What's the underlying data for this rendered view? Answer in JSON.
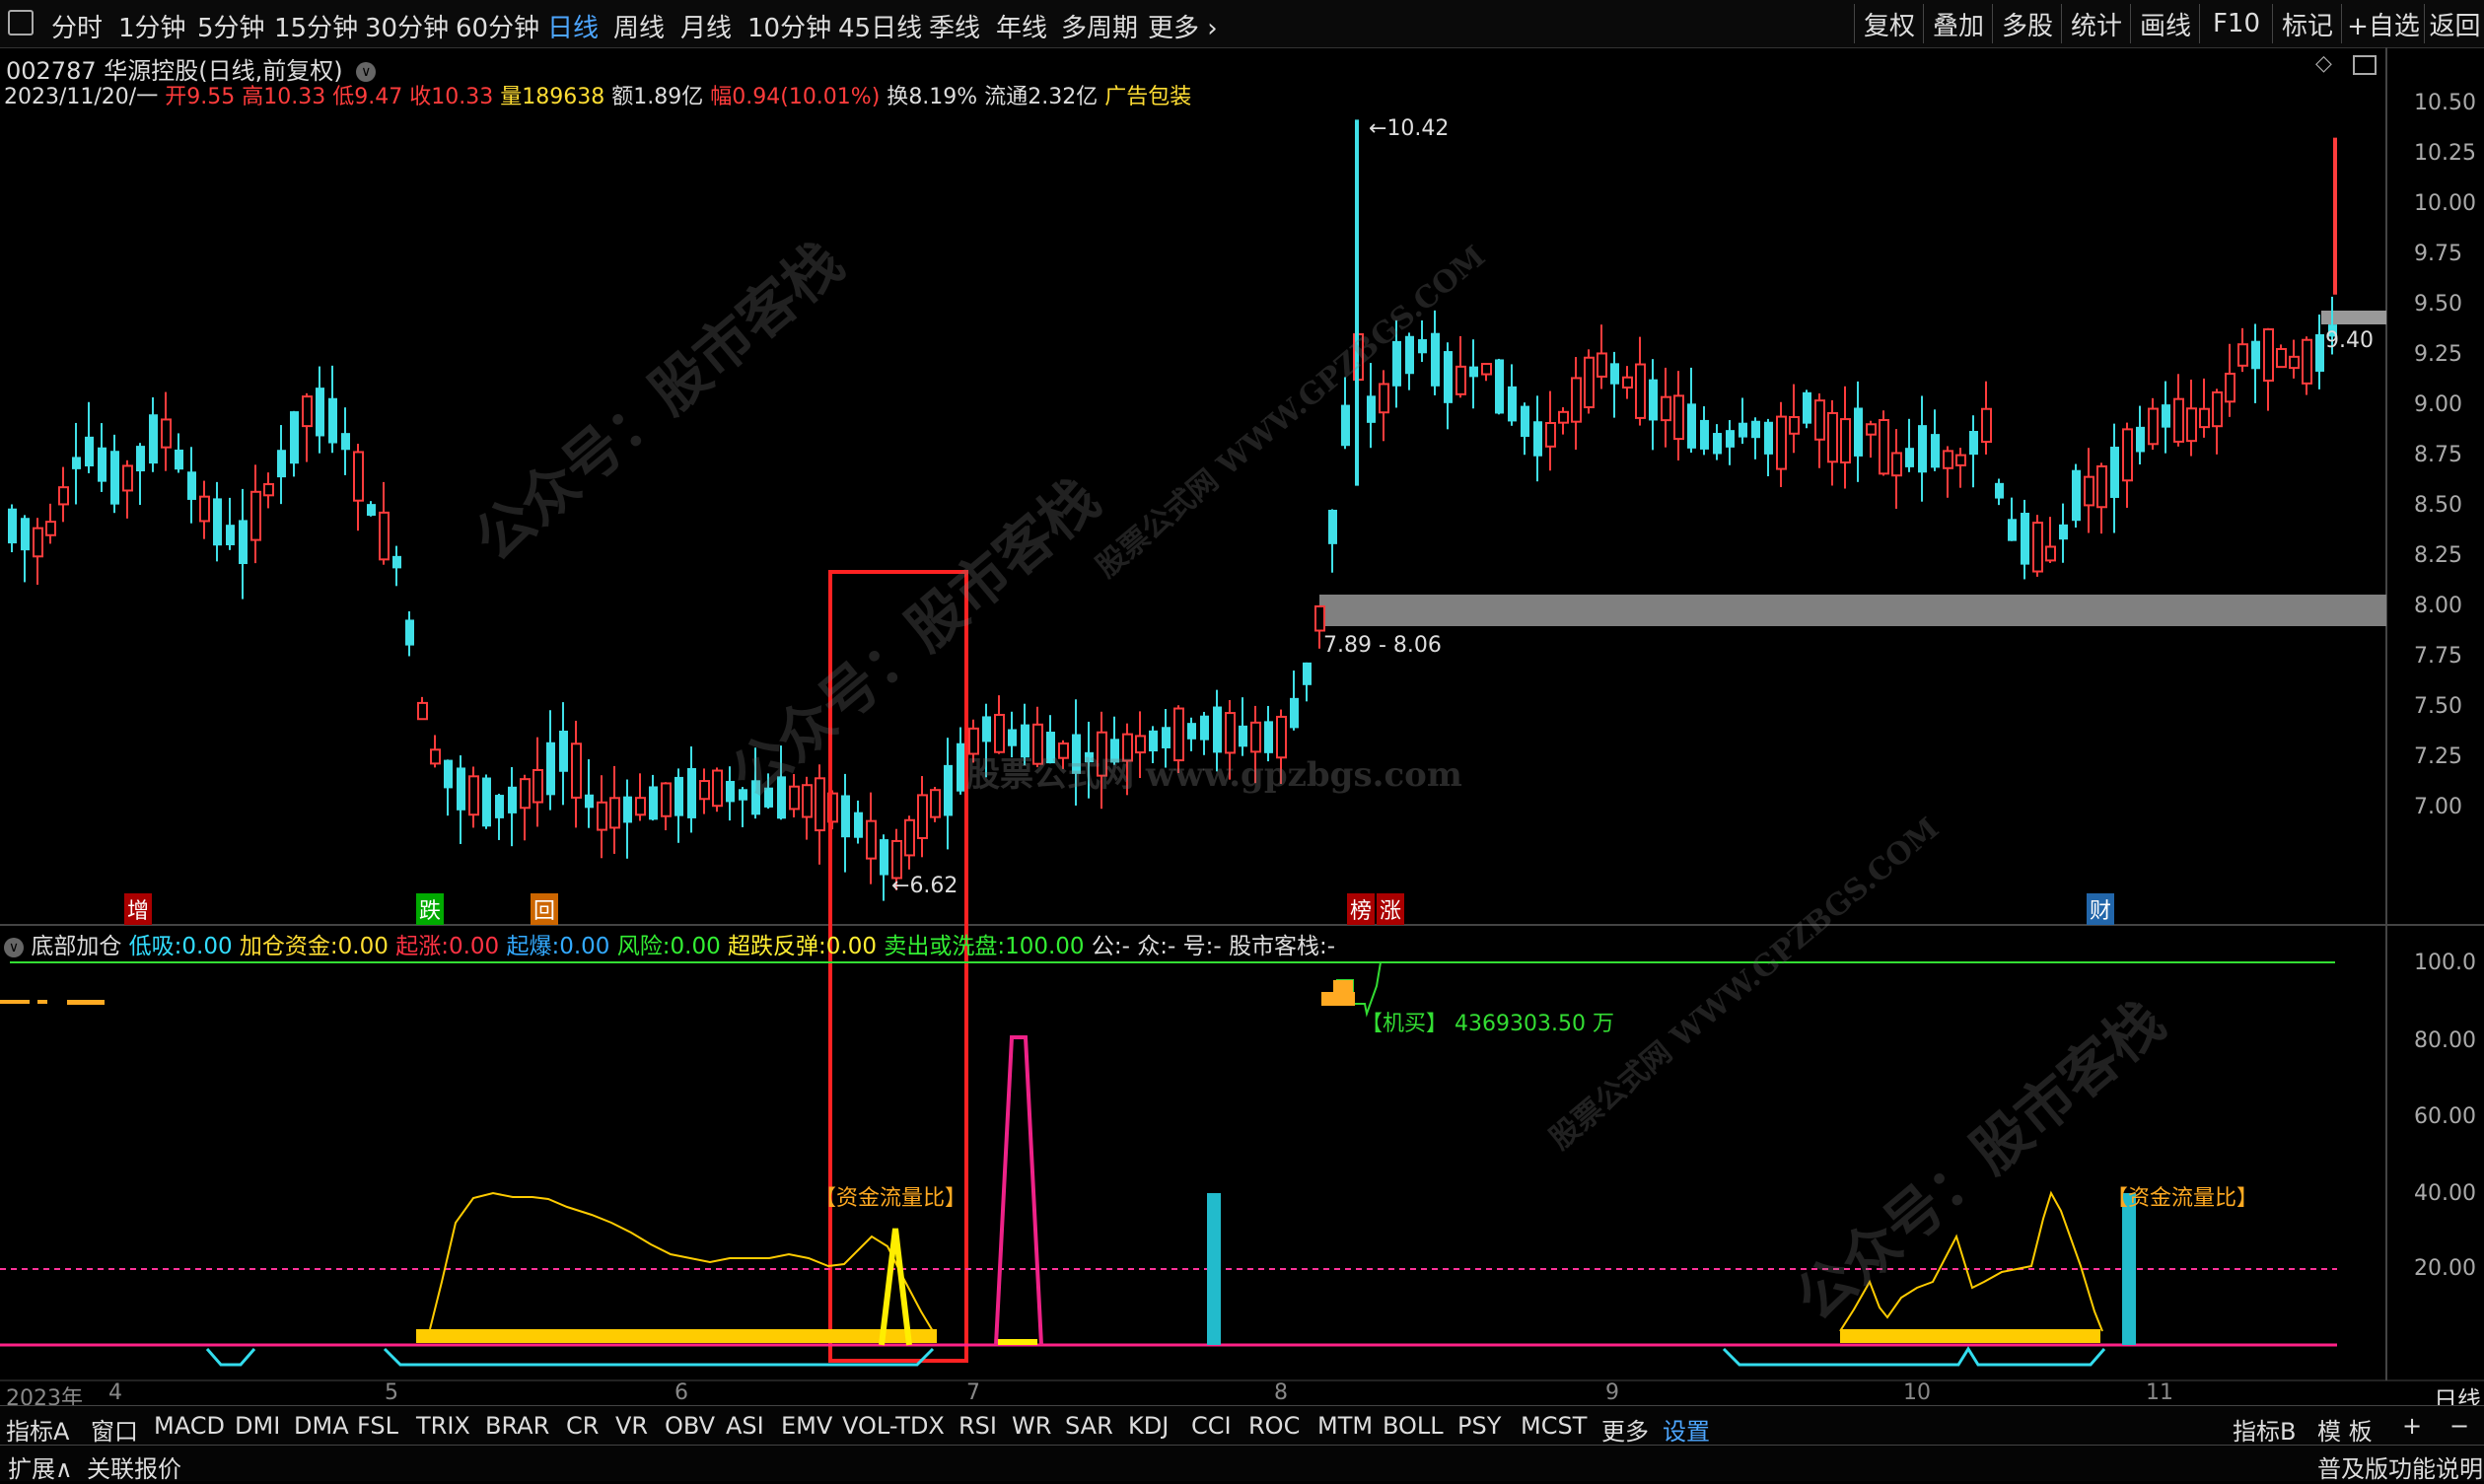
{
  "toolbar": {
    "menu_icon": "menu-icon",
    "periods": [
      "分时",
      "1分钟",
      "5分钟",
      "15分钟",
      "30分钟",
      "60分钟",
      "日线",
      "周线",
      "月线",
      "10分钟",
      "45日线",
      "季线",
      "年线",
      "多周期",
      "更多"
    ],
    "active_period": "日线",
    "right_buttons": [
      "复权",
      "叠加",
      "多股",
      "统计",
      "画线",
      "F10",
      "标记",
      "+自选",
      "返回"
    ]
  },
  "stock": {
    "title": "002787 华源控股(日线,前复权)",
    "date": "2023/11/20/一",
    "open_label": "开",
    "open": "9.55",
    "high_label": "高",
    "high": "10.33",
    "low_label": "低",
    "low": "9.47",
    "close_label": "收",
    "close": "10.33",
    "vol_label": "量",
    "vol": "189638",
    "amt_label": "额",
    "amt": "1.89亿",
    "chg_label": "幅",
    "chg": "0.94(10.01%)",
    "turn_label": "换",
    "turn": "8.19%",
    "float_label": "流通",
    "float": "2.32亿",
    "industry": "广告包装"
  },
  "price_axis": {
    "ticks": [
      "10.50",
      "10.25",
      "10.00",
      "9.75",
      "9.50",
      "9.25",
      "9.00",
      "8.75",
      "8.50",
      "8.25",
      "8.00",
      "7.75",
      "7.50",
      "7.25",
      "7.00"
    ],
    "current": "9.40"
  },
  "annotations": {
    "high": "10.42",
    "low": "6.62",
    "zone": "7.89 - 8.06",
    "markers": [
      {
        "label": "增",
        "color": "#ff4444"
      },
      {
        "label": "跌",
        "color": "#33dd33"
      },
      {
        "label": "回",
        "color": "#ff8844"
      },
      {
        "label": "榜",
        "color": "#ff4444"
      },
      {
        "label": "涨",
        "color": "#ff4444"
      },
      {
        "label": "财",
        "color": "#4da6ff"
      }
    ]
  },
  "indicator": {
    "name": "底部加仓",
    "items": [
      {
        "label": "低吸:",
        "value": "0.00",
        "color": "#33ddff"
      },
      {
        "label": "加仓资金:",
        "value": "0.00",
        "color": "#ffdd33"
      },
      {
        "label": "起涨:",
        "value": "0.00",
        "color": "#ff3344"
      },
      {
        "label": "起爆:",
        "value": "0.00",
        "color": "#33aaff"
      },
      {
        "label": "风险:",
        "value": "0.00",
        "color": "#33ee33"
      },
      {
        "label": "超跌反弹:",
        "value": "0.00",
        "color": "#ffee33"
      },
      {
        "label": "卖出或洗盘:",
        "value": "100.00",
        "color": "#33ee33"
      },
      {
        "label": "公:",
        "value": "-",
        "color": "#ddd"
      },
      {
        "label": "众:",
        "value": "-",
        "color": "#ddd"
      },
      {
        "label": "号:",
        "value": "-",
        "color": "#ddd"
      },
      {
        "label": "股市客栈:",
        "value": "-",
        "color": "#ddd"
      }
    ],
    "jimai_label": "【机买】",
    "jimai_value": "4369303.50 万",
    "flow_label_left": "【资金流量比】",
    "flow_label_right": "【资金流量比】",
    "axis_ticks": [
      "100.0",
      "80.00",
      "60.00",
      "40.00",
      "20.00"
    ]
  },
  "time_axis": {
    "labels": [
      "2023年",
      "4",
      "5",
      "6",
      "7",
      "8",
      "9",
      "10",
      "11"
    ],
    "period": "日线"
  },
  "bottom_tabs": {
    "row1": [
      "指标A",
      "窗口",
      "MACD",
      "DMI",
      "DMA",
      "FSL",
      "TRIX",
      "BRAR",
      "CR",
      "VR",
      "OBV",
      "ASI",
      "EMV",
      "VOL-TDX",
      "RSI",
      "WR",
      "SAR",
      "KDJ",
      "CCI",
      "ROC",
      "MTM",
      "BOLL",
      "PSY",
      "MCST",
      "更多",
      "设置"
    ],
    "selected": "设置",
    "row1_right": [
      "指标B",
      "模 板",
      "+",
      "−"
    ],
    "row2": [
      "扩展∧",
      "关联报价"
    ],
    "row2_right": "普及版功能说明"
  },
  "watermarks": [
    "公众号：股市客栈",
    "股票公式网 WWW.GPZBGS.COM",
    "股票公式网 www.gpzbgs.com"
  ],
  "colors": {
    "up": "#ff3c3c",
    "down": "#40e0e8",
    "highlight_box": "#ff2222",
    "zone": "#808080"
  }
}
